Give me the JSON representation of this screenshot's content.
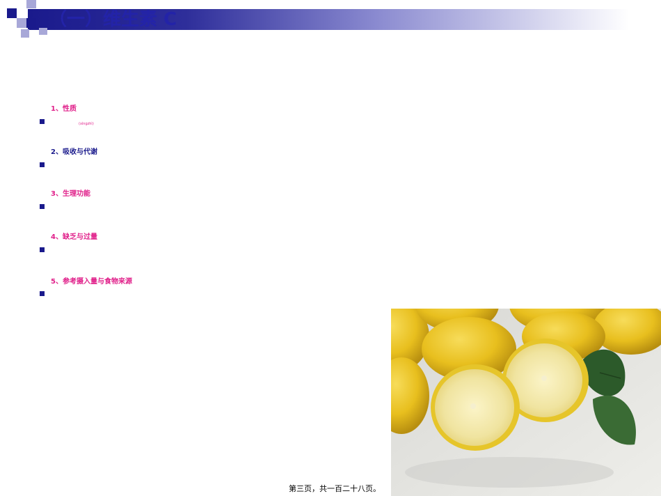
{
  "slide": {
    "title": "（一）维生素 C",
    "items": [
      {
        "label": "1、性质",
        "annotation": "(xìngzhì)"
      },
      {
        "label": "2、吸收与代谢"
      },
      {
        "label": "3、生理功能"
      },
      {
        "label": "4、缺乏与过量"
      },
      {
        "label": "5、参考摄入量与食物来源"
      }
    ],
    "footer": "第三页，共一百二十八页。"
  },
  "colors": {
    "title": "#2323a8",
    "pink": "#e0208a",
    "navy": "#1a1a8c"
  }
}
